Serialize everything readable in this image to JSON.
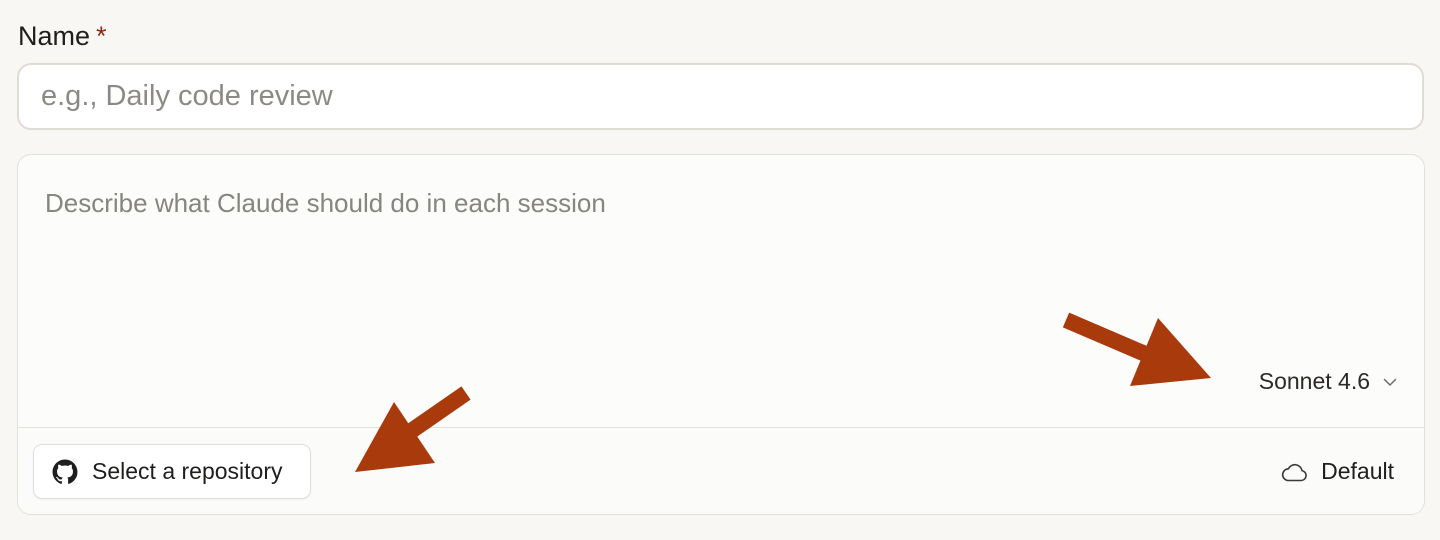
{
  "form": {
    "name_label": "Name",
    "required_mark": "*",
    "name_placeholder": "e.g., Daily code review",
    "name_value": "",
    "prompt_placeholder": "Describe what Claude should do in each session",
    "prompt_value": ""
  },
  "composer": {
    "model_label": "Sonnet 4.6",
    "model_icon": "chevron-down-icon",
    "repo_button_label": "Select a repository",
    "repo_icon": "github-icon",
    "environment_label": "Default",
    "environment_icon": "cloud-icon"
  },
  "annotations": {
    "arrow_color": "#a83a0c",
    "arrow_icons": [
      "arrow-to-model-selector",
      "arrow-to-repository-button"
    ]
  },
  "colors": {
    "background": "#f8f7f4",
    "required": "#8b2a12",
    "border": "#dedcd5",
    "placeholder": "#8b8a86"
  }
}
